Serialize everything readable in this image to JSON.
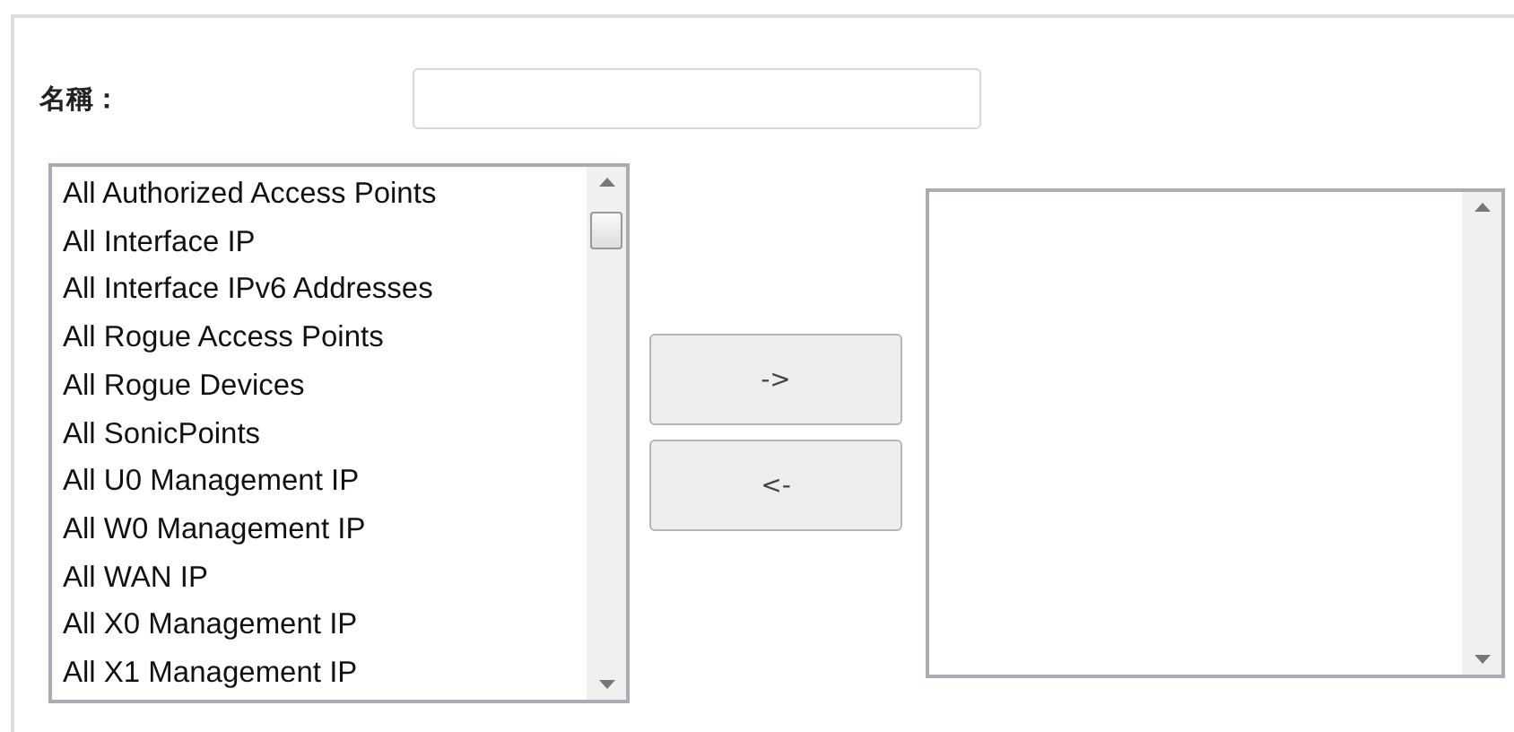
{
  "name_field": {
    "label": "名稱："
  },
  "available_list": {
    "items": [
      "All Authorized Access Points",
      "All Interface IP",
      "All Interface IPv6 Addresses",
      "All Rogue Access Points",
      "All Rogue Devices",
      "All SonicPoints",
      "All U0 Management IP",
      "All W0 Management IP",
      "All WAN IP",
      "All X0 Management IP",
      "All X1 Management IP"
    ]
  },
  "move_buttons": [
    {
      "label": "->"
    },
    {
      "label": "<-"
    }
  ]
}
